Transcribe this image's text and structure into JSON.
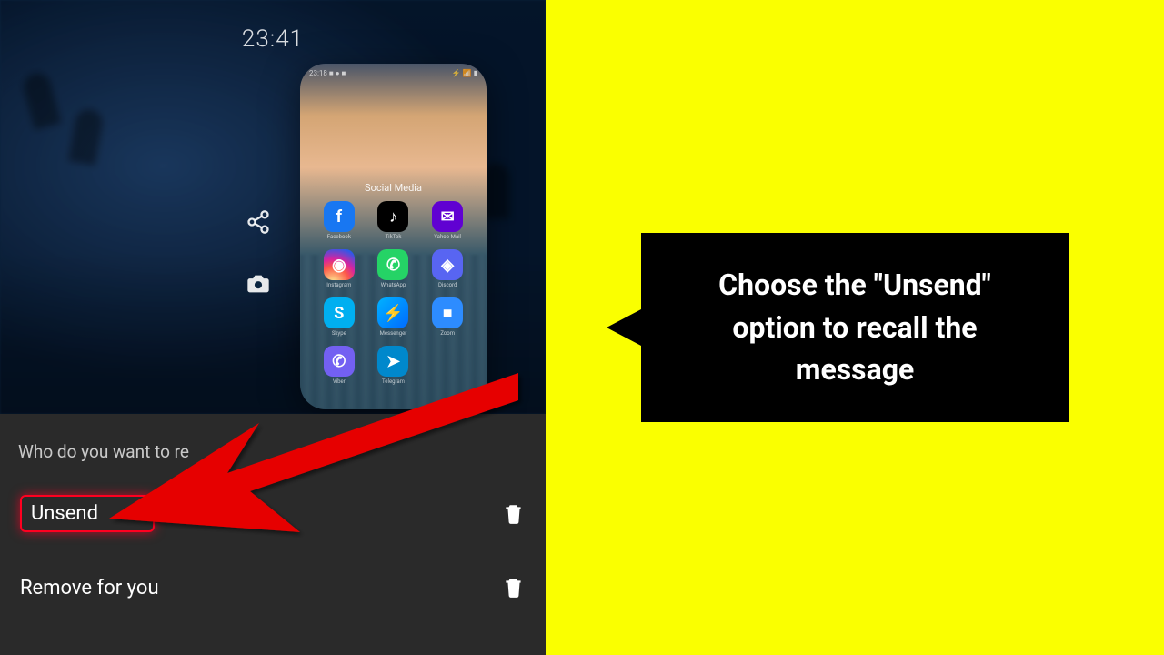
{
  "clock": "23:41",
  "folder": {
    "title": "Social Media",
    "apps": [
      {
        "name": "Facebook",
        "glyph": "f"
      },
      {
        "name": "TikTok",
        "glyph": "♪"
      },
      {
        "name": "Yahoo Mail",
        "glyph": "✉"
      },
      {
        "name": "Instagram",
        "glyph": "◉"
      },
      {
        "name": "WhatsApp",
        "glyph": "✆"
      },
      {
        "name": "Discord",
        "glyph": "◈"
      },
      {
        "name": "Skype",
        "glyph": "S"
      },
      {
        "name": "Messenger",
        "glyph": "⚡"
      },
      {
        "name": "Zoom",
        "glyph": "■"
      },
      {
        "name": "Viber",
        "glyph": "✆"
      },
      {
        "name": "Telegram",
        "glyph": "➤"
      }
    ]
  },
  "sheet": {
    "prompt": "Who do you want to re",
    "option_unsend": "Unsend",
    "option_remove": "Remove for you"
  },
  "callout": "Choose the \"Unsend\" option to recall the message"
}
